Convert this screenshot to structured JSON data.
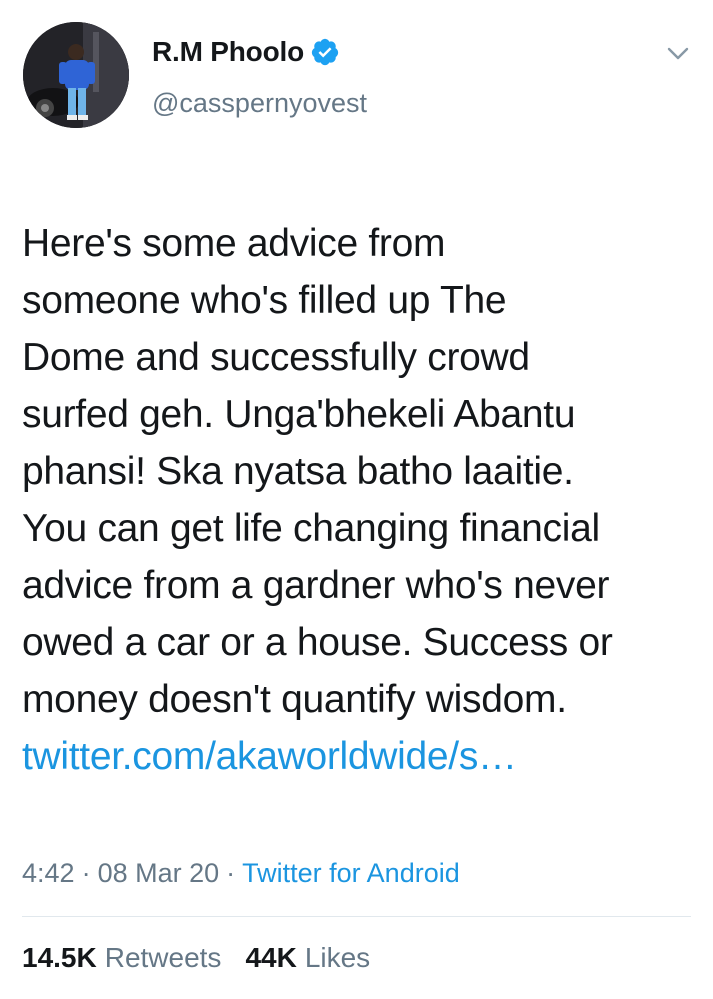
{
  "user": {
    "display_name": "R.M Phoolo",
    "handle": "@casspernyovest",
    "verified": true,
    "avatar_icon": "profile-photo"
  },
  "tweet": {
    "text": "Here's some advice from\nsomeone who's filled up The\nDome and successfully crowd\nsurfed geh. Unga'bhekeli Abantu\nphansi! Ska nyatsa batho laaitie.\nYou can get life changing financial\nadvice from a gardner who's never\nowed a car or a house. Success or\nmoney doesn't quantify wisdom.",
    "link": "twitter.com/akaworldwide/s…"
  },
  "meta": {
    "time": "4:42",
    "separator": "·",
    "date": "08 Mar 20",
    "source": "Twitter for Android"
  },
  "stats": {
    "retweets_count": "14.5K",
    "retweets_label": "Retweets",
    "likes_count": "44K",
    "likes_label": "Likes"
  },
  "colors": {
    "text": "#14171a",
    "secondary": "#657786",
    "link": "#1b95e0",
    "verified": "#1da1f2",
    "divider": "#e1e8ed"
  }
}
